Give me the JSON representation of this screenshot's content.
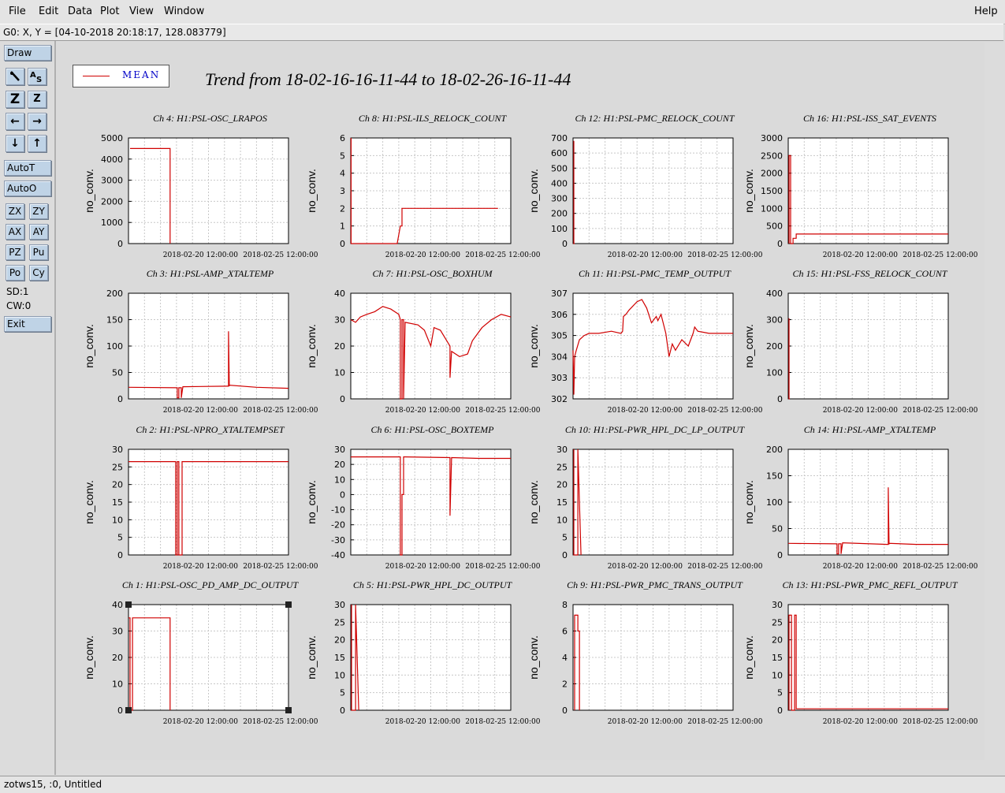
{
  "menu": {
    "file": "File",
    "edit": "Edit",
    "data": "Data",
    "plot": "Plot",
    "view": "View",
    "window": "Window",
    "help": "Help"
  },
  "coord_readout": "G0: X, Y = [04-10-2018 20:18:17, 128.083779]",
  "toolbar": {
    "draw": "Draw",
    "autot": "AutoT",
    "autoo": "AutoO",
    "zx": "ZX",
    "zy": "ZY",
    "ax": "AX",
    "ay": "AY",
    "pz": "PZ",
    "pu": "Pu",
    "po": "Po",
    "cy": "Cy",
    "sd": "SD:1",
    "cw": "CW:0",
    "exit": "Exit",
    "icons": [
      "zoom-icon",
      "autoscale-icon",
      "zoom-in-icon",
      "zoom-out-icon",
      "pan-left-icon",
      "pan-right-icon",
      "pan-down-icon",
      "pan-up-icon"
    ]
  },
  "status": "zotws15, :0, Untitled",
  "legend": {
    "label": "MEAN",
    "color": "#d00000"
  },
  "title": "Trend from 18-02-16-16-11-44 to 18-02-26-16-11-44",
  "chart_data": [
    {
      "type": "line",
      "title": "Ch 4: H1:PSL-OSC_LRAPOS",
      "ylabel": "no_conv.",
      "ylim": [
        0,
        5000
      ],
      "yticks": [
        0,
        1000,
        2000,
        3000,
        4000,
        5000
      ],
      "xticks": [
        "2018-02-20 12:00:00",
        "2018-02-25 12:00:00"
      ],
      "xlim": [
        0,
        10
      ],
      "grid": true,
      "series": [
        {
          "x": [
            0.1,
            2.6,
            2.6
          ],
          "y": [
            4500,
            4500,
            0
          ]
        }
      ]
    },
    {
      "type": "line",
      "title": "Ch 8: H1:PSL-ILS_RELOCK_COUNT",
      "ylabel": "no_conv.",
      "ylim": [
        0,
        6
      ],
      "yticks": [
        0,
        1,
        2,
        3,
        4,
        5,
        6
      ],
      "xticks": [
        "2018-02-20 12:00:00",
        "2018-02-25 12:00:00"
      ],
      "xlim": [
        0,
        10
      ],
      "grid": true,
      "series": [
        {
          "x": [
            0.02,
            0.02,
            0.05,
            0.05,
            2.9,
            3.1,
            3.1,
            3.2,
            3.2,
            9.2
          ],
          "y": [
            6,
            0,
            0,
            0,
            0,
            1,
            1,
            1,
            2,
            2
          ]
        }
      ]
    },
    {
      "type": "line",
      "title": "Ch 12: H1:PSL-PMC_RELOCK_COUNT",
      "ylabel": "no_conv.",
      "ylim": [
        0,
        700
      ],
      "yticks": [
        0,
        100,
        200,
        300,
        400,
        500,
        600,
        700
      ],
      "xticks": [
        "2018-02-20 12:00:00",
        "2018-02-25 12:00:00"
      ],
      "xlim": [
        0,
        10
      ],
      "grid": true,
      "series": [
        {
          "x": [
            0.05,
            0.05,
            0.1
          ],
          "y": [
            680,
            0,
            0
          ]
        }
      ]
    },
    {
      "type": "line",
      "title": "Ch 16: H1:PSL-ISS_SAT_EVENTS",
      "ylabel": "no_conv.",
      "ylim": [
        0,
        3000
      ],
      "yticks": [
        0,
        500,
        1000,
        1500,
        2000,
        2500,
        3000
      ],
      "xticks": [
        "2018-02-20 12:00:00",
        "2018-02-25 12:00:00"
      ],
      "xlim": [
        0,
        10
      ],
      "grid": true,
      "series": [
        {
          "x": [
            0.05,
            0.05,
            0.15,
            0.15,
            0.3,
            0.3,
            0.5,
            0.5,
            10
          ],
          "y": [
            0,
            2500,
            2500,
            0,
            0,
            150,
            150,
            270,
            270
          ]
        }
      ]
    },
    {
      "type": "line",
      "title": "Ch 3: H1:PSL-AMP_XTALTEMP",
      "ylabel": "no_conv.",
      "ylim": [
        0,
        200
      ],
      "yticks": [
        0,
        50,
        100,
        150,
        200
      ],
      "xticks": [
        "2018-02-20 12:00:00",
        "2018-02-25 12:00:00"
      ],
      "xlim": [
        0,
        10
      ],
      "grid": true,
      "series": [
        {
          "x": [
            0,
            3,
            3.05,
            3.05,
            3.15,
            3.15,
            3.3,
            3.3,
            3.4,
            6.2,
            6.25,
            6.25,
            6.3,
            6.3,
            8,
            10
          ],
          "y": [
            22,
            21,
            21,
            2,
            2,
            21,
            21,
            2,
            23,
            24,
            24,
            128,
            24,
            26,
            22,
            20
          ]
        }
      ]
    },
    {
      "type": "line",
      "title": "Ch 7: H1:PSL-OSC_BOXHUM",
      "ylabel": "no_conv.",
      "ylim": [
        0,
        40
      ],
      "yticks": [
        0,
        10,
        20,
        30,
        40
      ],
      "xticks": [
        "2018-02-20 12:00:00",
        "2018-02-25 12:00:00"
      ],
      "xlim": [
        0,
        10
      ],
      "grid": true,
      "series": [
        {
          "x": [
            0,
            0.3,
            0.6,
            1.0,
            1.5,
            2.0,
            2.5,
            3.0,
            3.1,
            3.1,
            3.2,
            3.2,
            3.3,
            3.3,
            3.4,
            4.2,
            4.6,
            5.0,
            5.2,
            5.6,
            6.0,
            6.2,
            6.2,
            6.3,
            6.8,
            7.3,
            7.6,
            8.2,
            8.8,
            9.4,
            10
          ],
          "y": [
            30,
            29,
            31,
            32,
            33,
            35,
            34,
            32,
            30,
            0,
            0,
            30,
            30,
            0,
            29,
            28,
            26,
            20,
            27,
            26,
            22,
            20,
            8,
            18,
            16,
            17,
            22,
            27,
            30,
            32,
            31
          ]
        }
      ]
    },
    {
      "type": "line",
      "title": "Ch 11: H1:PSL-PMC_TEMP_OUTPUT",
      "ylabel": "no_conv.",
      "ylim": [
        302,
        307
      ],
      "yticks": [
        302,
        303,
        304,
        305,
        306,
        307
      ],
      "xticks": [
        "2018-02-20 12:00:00",
        "2018-02-25 12:00:00"
      ],
      "xlim": [
        0,
        10
      ],
      "grid": true,
      "series": [
        {
          "x": [
            0,
            0.05,
            0.1,
            0.2,
            0.4,
            0.7,
            1.0,
            1.6,
            2.4,
            3.0,
            3.1,
            3.15,
            3.3,
            3.5,
            4.0,
            4.3,
            4.6,
            4.9,
            5.2,
            5.3,
            5.5,
            5.8,
            6.0,
            6.2,
            6.4,
            6.8,
            7.2,
            7.5,
            7.6,
            7.8,
            8.5,
            10
          ],
          "y": [
            304.3,
            302.2,
            304.0,
            304.3,
            304.8,
            305.0,
            305.1,
            305.1,
            305.2,
            305.1,
            305.2,
            305.9,
            306.0,
            306.2,
            306.6,
            306.7,
            306.3,
            305.6,
            305.9,
            305.7,
            306.0,
            305.1,
            304.0,
            304.6,
            304.3,
            304.8,
            304.5,
            305.1,
            305.4,
            305.2,
            305.1,
            305.1
          ]
        }
      ]
    },
    {
      "type": "line",
      "title": "Ch 15: H1:PSL-FSS_RELOCK_COUNT",
      "ylabel": "no_conv.",
      "ylim": [
        0,
        400
      ],
      "yticks": [
        0,
        100,
        200,
        300,
        400
      ],
      "xticks": [
        "2018-02-20 12:00:00",
        "2018-02-25 12:00:00"
      ],
      "xlim": [
        0,
        10
      ],
      "grid": true,
      "series": [
        {
          "x": [
            0.05,
            0.05,
            0.1
          ],
          "y": [
            305,
            0,
            0
          ]
        }
      ]
    },
    {
      "type": "line",
      "title": "Ch 2: H1:PSL-NPRO_XTALTEMPSET",
      "ylabel": "no_conv.",
      "ylim": [
        0,
        30
      ],
      "yticks": [
        0,
        5,
        10,
        15,
        20,
        25,
        30
      ],
      "xticks": [
        "2018-02-20 12:00:00",
        "2018-02-25 12:00:00"
      ],
      "xlim": [
        0,
        10
      ],
      "grid": true,
      "series": [
        {
          "x": [
            0,
            2.95,
            2.95,
            3.05,
            3.05,
            3.15,
            3.15,
            3.35,
            3.35,
            10
          ],
          "y": [
            26.5,
            26.5,
            0,
            0,
            26.5,
            26.5,
            0,
            0,
            26.5,
            26.5
          ]
        }
      ]
    },
    {
      "type": "line",
      "title": "Ch 6: H1:PSL-OSC_BOXTEMP",
      "ylabel": "no_conv.",
      "ylim": [
        -40,
        30
      ],
      "yticks": [
        -40,
        -30,
        -20,
        -10,
        0,
        10,
        20,
        30
      ],
      "xticks": [
        "2018-02-20 12:00:00",
        "2018-02-25 12:00:00"
      ],
      "xlim": [
        0,
        10
      ],
      "grid": true,
      "series": [
        {
          "x": [
            0,
            3.1,
            3.1,
            3.2,
            3.2,
            3.3,
            3.3,
            3.4,
            6.2,
            6.2,
            6.3,
            8,
            10
          ],
          "y": [
            25,
            25,
            -40,
            -40,
            0,
            0,
            25,
            25,
            24.5,
            -14,
            24.5,
            24,
            24
          ]
        }
      ]
    },
    {
      "type": "line",
      "title": "Ch 10: H1:PSL-PWR_HPL_DC_LP_OUTPUT",
      "ylabel": "no_conv.",
      "ylim": [
        0,
        30
      ],
      "yticks": [
        0,
        5,
        10,
        15,
        20,
        25,
        30
      ],
      "xticks": [
        "2018-02-20 12:00:00",
        "2018-02-25 12:00:00"
      ],
      "xlim": [
        0,
        10
      ],
      "grid": true,
      "series": [
        {
          "x": [
            0.05,
            0.05,
            0.3,
            0.3,
            0.5
          ],
          "y": [
            30,
            0,
            0,
            30,
            0
          ]
        }
      ]
    },
    {
      "type": "line",
      "title": "Ch 14: H1:PSL-AMP_XTALTEMP",
      "ylabel": "no_conv.",
      "ylim": [
        0,
        200
      ],
      "yticks": [
        0,
        50,
        100,
        150,
        200
      ],
      "xticks": [
        "2018-02-20 12:00:00",
        "2018-02-25 12:00:00"
      ],
      "xlim": [
        0,
        10
      ],
      "grid": true,
      "series": [
        {
          "x": [
            0,
            3,
            3.05,
            3.05,
            3.15,
            3.15,
            3.3,
            3.3,
            3.4,
            6.2,
            6.25,
            6.25,
            6.3,
            6.3,
            8,
            10
          ],
          "y": [
            22,
            21,
            21,
            2,
            2,
            21,
            21,
            2,
            23,
            20,
            20,
            128,
            20,
            22,
            20,
            20
          ]
        }
      ]
    },
    {
      "type": "line",
      "title": "Ch 1: H1:PSL-OSC_PD_AMP_DC_OUTPUT",
      "ylabel": "no_conv.",
      "ylim": [
        0,
        40
      ],
      "yticks": [
        0,
        10,
        20,
        30,
        40
      ],
      "xticks": [
        "2018-02-20 12:00:00",
        "2018-02-25 12:00:00"
      ],
      "xlim": [
        0,
        10
      ],
      "grid": true,
      "series": [
        {
          "x": [
            0,
            0.1,
            0.1,
            0.25,
            0.25,
            2.6,
            2.6
          ],
          "y": [
            35,
            35,
            0,
            0,
            35,
            35,
            0
          ]
        }
      ]
    },
    {
      "type": "line",
      "title": "Ch 5: H1:PSL-PWR_HPL_DC_OUTPUT",
      "ylabel": "no_conv.",
      "ylim": [
        0,
        30
      ],
      "yticks": [
        0,
        5,
        10,
        15,
        20,
        25,
        30
      ],
      "xticks": [
        "2018-02-20 12:00:00",
        "2018-02-25 12:00:00"
      ],
      "xlim": [
        0,
        10
      ],
      "grid": true,
      "series": [
        {
          "x": [
            0.05,
            0.05,
            0.3,
            0.3,
            0.5
          ],
          "y": [
            30,
            0,
            0,
            30,
            0
          ]
        }
      ]
    },
    {
      "type": "line",
      "title": "Ch 9: H1:PSL-PWR_PMC_TRANS_OUTPUT",
      "ylabel": "no_conv.",
      "ylim": [
        0,
        8
      ],
      "yticks": [
        0,
        2,
        4,
        6,
        8
      ],
      "xticks": [
        "2018-02-20 12:00:00",
        "2018-02-25 12:00:00"
      ],
      "xlim": [
        0,
        10
      ],
      "grid": true,
      "series": [
        {
          "x": [
            0.1,
            0.1,
            0.3,
            0.3,
            0.4,
            0.4
          ],
          "y": [
            0,
            7.2,
            7.2,
            6.0,
            6.0,
            0
          ]
        }
      ]
    },
    {
      "type": "line",
      "title": "Ch 13: H1:PSL-PWR_PMC_REFL_OUTPUT",
      "ylabel": "no_conv.",
      "ylim": [
        0,
        30
      ],
      "yticks": [
        0,
        5,
        10,
        15,
        20,
        25,
        30
      ],
      "xticks": [
        "2018-02-20 12:00:00",
        "2018-02-25 12:00:00"
      ],
      "xlim": [
        0,
        10
      ],
      "grid": true,
      "series": [
        {
          "x": [
            0.05,
            0.05,
            0.2,
            0.2,
            0.4,
            0.4,
            0.5,
            0.5,
            10
          ],
          "y": [
            0,
            27,
            27,
            0,
            0,
            27,
            27,
            0.4,
            0.4
          ]
        }
      ]
    }
  ]
}
